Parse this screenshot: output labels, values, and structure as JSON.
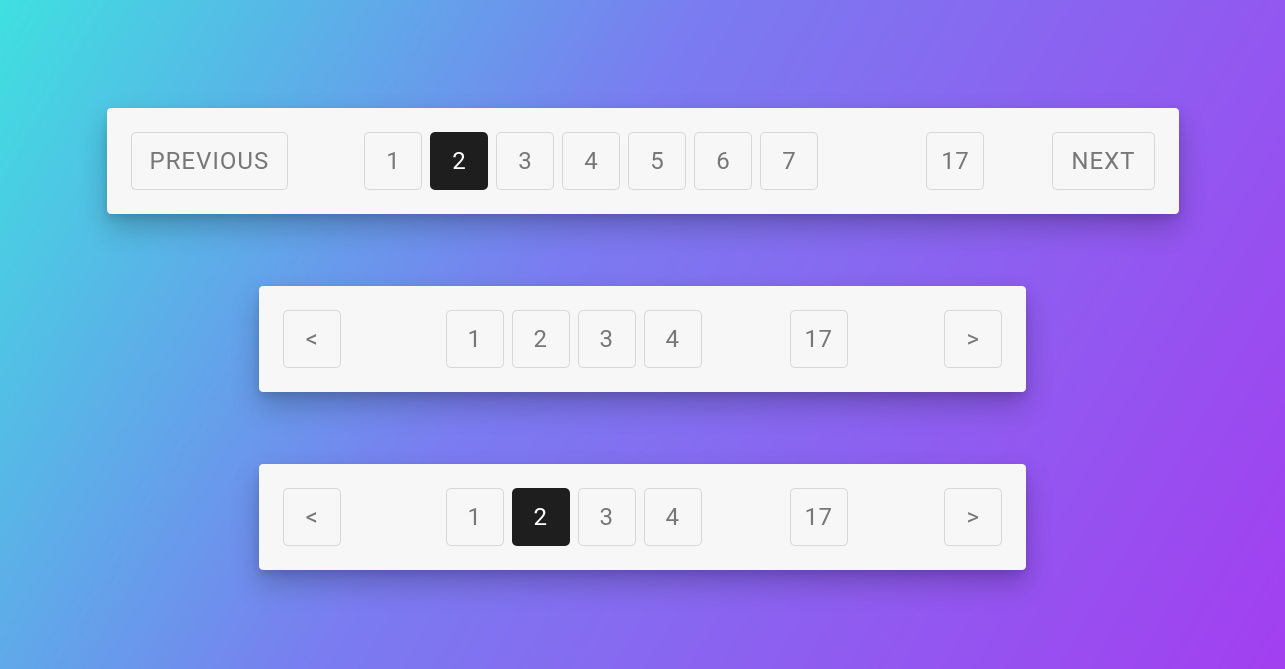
{
  "pager1": {
    "prev_label": "PREVIOUS",
    "next_label": "NEXT",
    "active_index": 1,
    "pages": [
      "1",
      "2",
      "3",
      "4",
      "5",
      "6",
      "7"
    ],
    "last_page": "17"
  },
  "pager2": {
    "prev_symbol": "<",
    "next_symbol": ">",
    "active_index": -1,
    "pages": [
      "1",
      "2",
      "3",
      "4"
    ],
    "last_page": "17"
  },
  "pager3": {
    "prev_symbol": "<",
    "next_symbol": ">",
    "active_index": 1,
    "pages": [
      "1",
      "2",
      "3",
      "4"
    ],
    "last_page": "17"
  }
}
